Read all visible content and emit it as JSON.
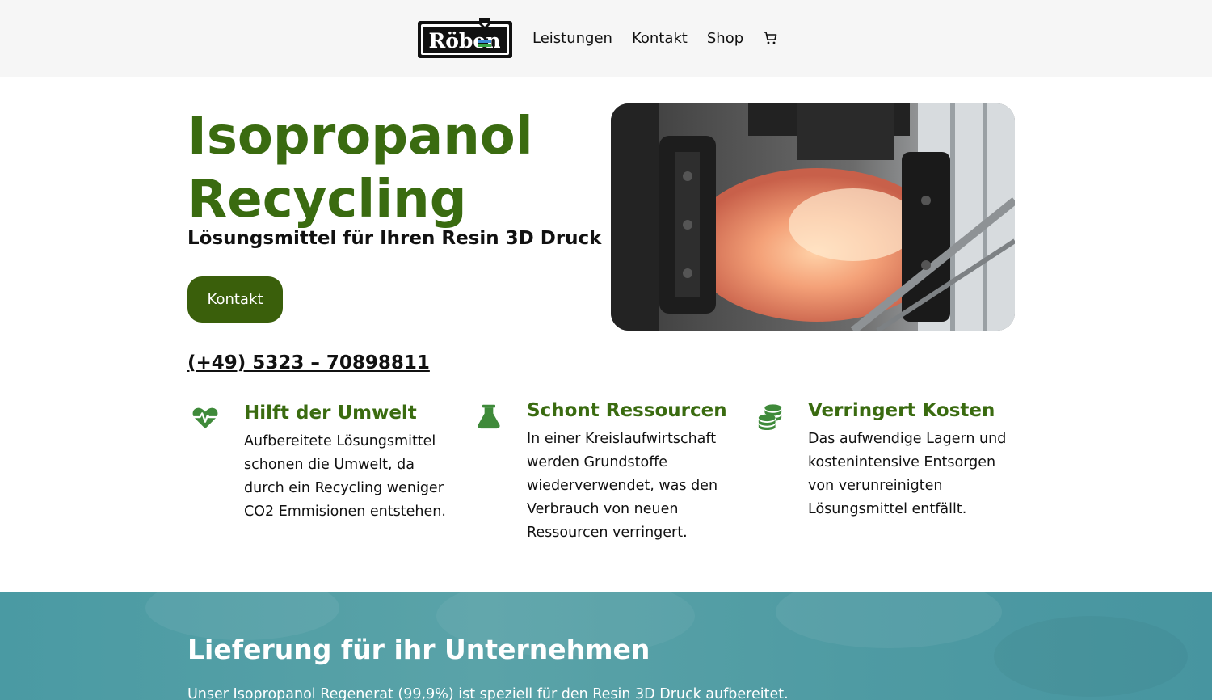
{
  "header": {
    "logo_text": "Röben",
    "nav": [
      "Leistungen",
      "Kontakt",
      "Shop"
    ],
    "cart_icon": "cart-icon"
  },
  "hero": {
    "title_line1": "Isopropanol",
    "title_line2": "Recycling",
    "subtitle": "Lösungsmittel für Ihren Resin 3D Druck",
    "button_label": "Kontakt",
    "phone": "(+49) 5323 – 70898811",
    "image_icon": "recycling-apparatus-photo"
  },
  "features": [
    {
      "icon": "heartbeat-icon",
      "title": "Hilft der Umwelt",
      "text": "Aufbereitete Lösungsmittel schonen die Umwelt, da durch ein Recycling weniger CO2 Emmisionen entstehen."
    },
    {
      "icon": "flask-icon",
      "title": "Schont Ressourcen",
      "text": "In einer Kreislaufwirtschaft werden Grundstoffe wiederverwendet, was den Verbrauch von neuen Ressourcen verringert."
    },
    {
      "icon": "coins-icon",
      "title": "Verringert Kosten",
      "text": "Das aufwendige Lagern und kostenintensive Entsorgen von verunreinigten Lösungsmittel entfällt."
    }
  ],
  "band": {
    "title": "Lieferung für ihr Unternehmen",
    "text": "Unser Isopropanol Regenerat (99,9%) ist speziell für den Resin 3D Druck aufbereitet."
  },
  "colors": {
    "accent_green": "#3a6b10",
    "button_green": "#3a5f0b",
    "icon_green": "#3f8a3a",
    "band_teal": "#4f9ba3"
  }
}
